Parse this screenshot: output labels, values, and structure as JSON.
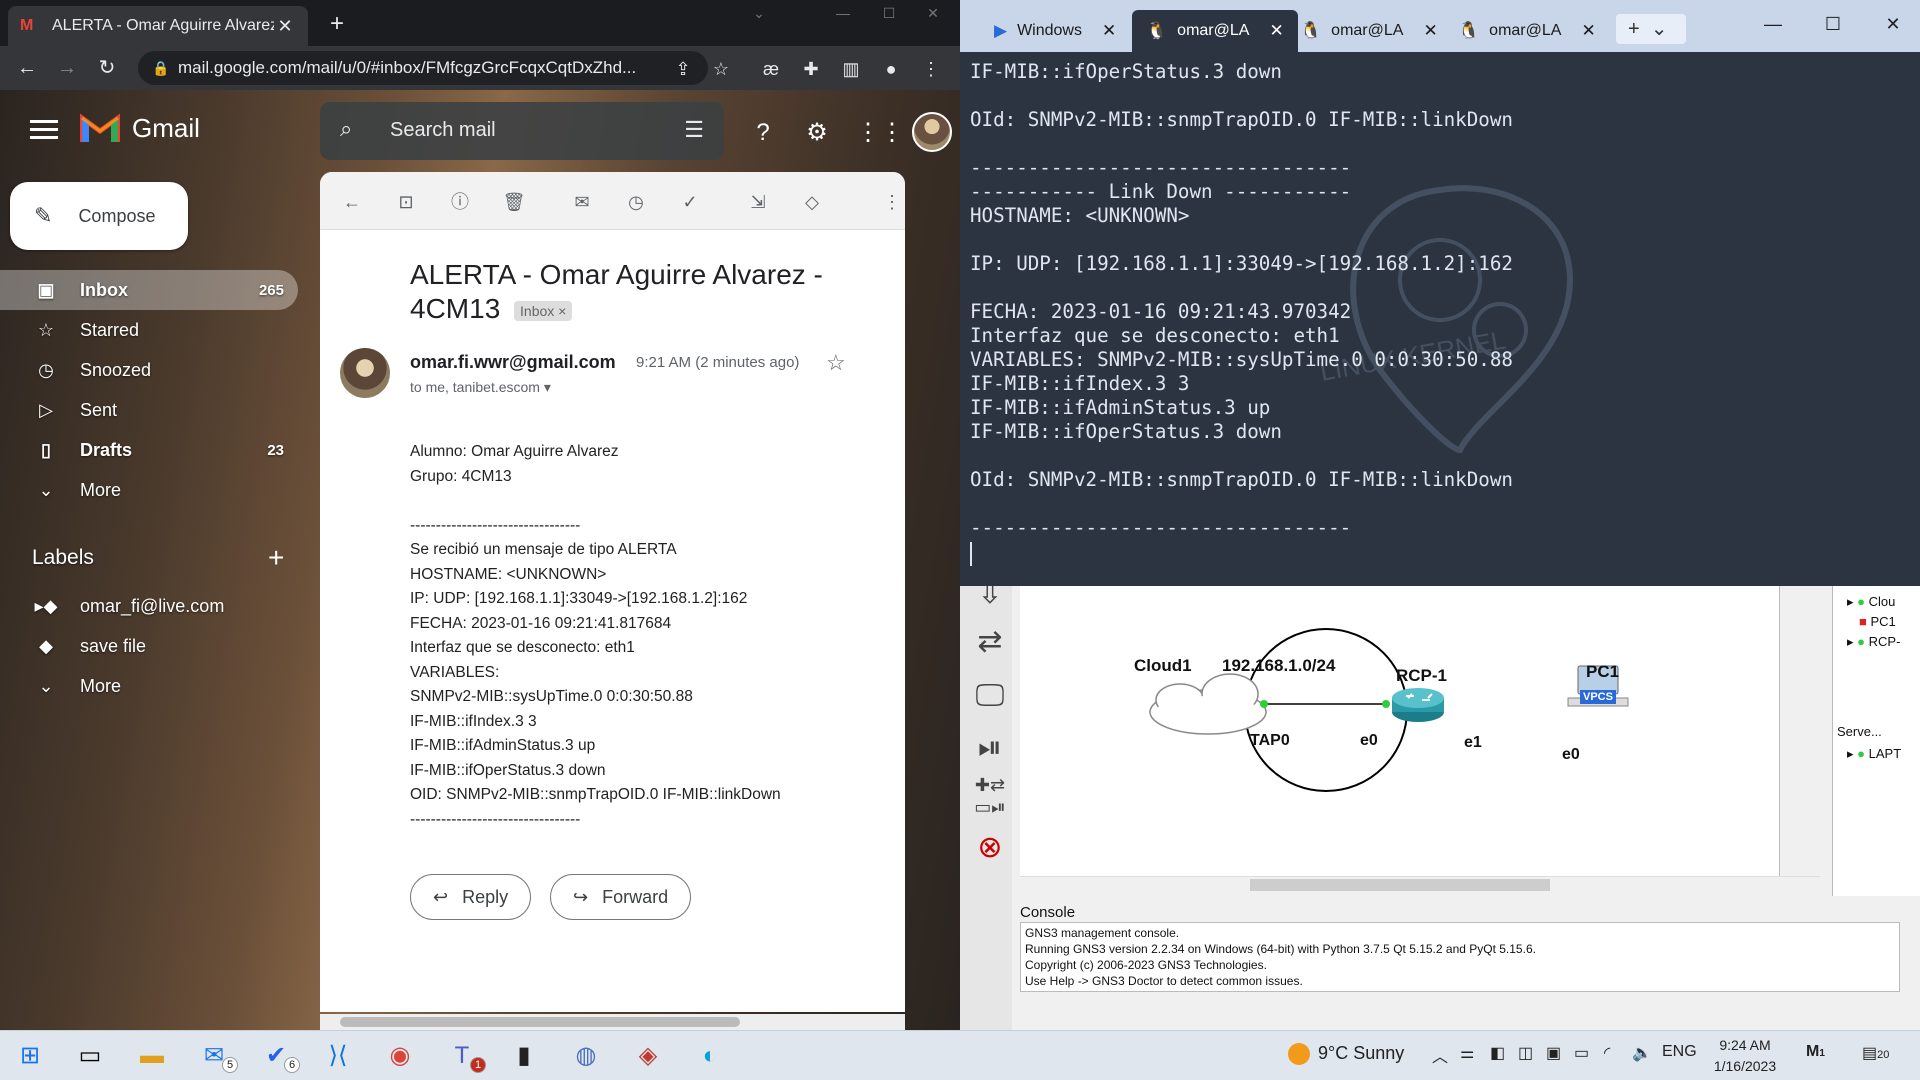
{
  "browser": {
    "tab_title": "ALERTA - Omar Aguirre Alvarez -",
    "url": "mail.google.com/mail/u/0/#inbox/FMfcgzGrcFcqxCqtDxZhd..."
  },
  "gmail": {
    "brand": "Gmail",
    "search_placeholder": "Search mail",
    "compose_label": "Compose",
    "nav": [
      {
        "label": "Inbox",
        "count": "265",
        "icon": "inbox-icon"
      },
      {
        "label": "Starred",
        "count": "",
        "icon": "star-icon"
      },
      {
        "label": "Snoozed",
        "count": "",
        "icon": "clock-icon"
      },
      {
        "label": "Sent",
        "count": "",
        "icon": "send-icon"
      },
      {
        "label": "Drafts",
        "count": "23",
        "icon": "draft-icon"
      },
      {
        "label": "More",
        "count": "",
        "icon": "chevron-down-icon"
      }
    ],
    "labels_heading": "Labels",
    "labels": [
      {
        "label": "omar_fi@live.com"
      },
      {
        "label": "save file"
      },
      {
        "label": "More"
      }
    ],
    "message": {
      "subject": "ALERTA - Omar Aguirre Alvarez - 4CM13",
      "chip": "Inbox",
      "from": "omar.fi.wwr@gmail.com",
      "time": "9:21 AM (2 minutes ago)",
      "to": "to me, tanibet.escom",
      "body": "Alumno: Omar Aguirre Alvarez\nGrupo: 4CM13\n\n---------------------------------\nSe recibió un mensaje de tipo ALERTA\nHOSTNAME: <UNKNOWN>\nIP: UDP: [192.168.1.1]:33049->[192.168.1.2]:162\nFECHA: 2023-01-16 09:21:41.817684\nInterfaz que se desconecto: eth1\nVARIABLES:\nSNMPv2-MIB::sysUpTime.0 0:0:30:50.88\nIF-MIB::ifIndex.3 3\nIF-MIB::ifAdminStatus.3 up\nIF-MIB::ifOperStatus.3 down\nOID: SNMPv2-MIB::snmpTrapOID.0 IF-MIB::linkDown\n---------------------------------",
      "reply_label": "Reply",
      "forward_label": "Forward"
    }
  },
  "terminal": {
    "tabs": [
      {
        "label": "Windows",
        "icon": "powershell-icon"
      },
      {
        "label": "omar@LA",
        "icon": "linux-icon"
      },
      {
        "label": "omar@LA",
        "icon": "linux-icon"
      },
      {
        "label": "omar@LA",
        "icon": "linux-icon"
      }
    ],
    "watermark": "LINUX KERNEL",
    "text": "IF-MIB::ifOperStatus.3 down\n\nOId: SNMPv2-MIB::snmpTrapOID.0 IF-MIB::linkDown\n\n---------------------------------\n----------- Link Down -----------\nHOSTNAME: <UNKNOWN>\n\nIP: UDP: [192.168.1.1]:33049->[192.168.1.2]:162\n\nFECHA: 2023-01-16 09:21:43.970342\nInterfaz que se desconecto: eth1\nVARIABLES: SNMPv2-MIB::sysUpTime.0 0:0:30:50.88\nIF-MIB::ifIndex.3 3\nIF-MIB::ifAdminStatus.3 up\nIF-MIB::ifOperStatus.3 down\n\nOId: SNMPv2-MIB::snmpTrapOID.0 IF-MIB::linkDown\n\n---------------------------------"
  },
  "gns3": {
    "nodes": {
      "cloud": "Cloud1",
      "network": "192.168.1.0/24",
      "router": "RCP-1",
      "pc": "PC1",
      "pc_badge": "VPCS",
      "tap": "TAP0",
      "router_e0": "e0",
      "router_e1": "e1",
      "pc_e0": "e0"
    },
    "topology_items": [
      "Clou",
      "PC1",
      "RCP-"
    ],
    "servers_label": "Serve...",
    "server_item": "LAPT",
    "console_title": "Console",
    "console_text": "GNS3 management console.\nRunning GNS3 version 2.2.34 on Windows (64-bit) with Python 3.7.5 Qt 5.15.2 and PyQt 5.15.6.\nCopyright (c) 2006-2023 GNS3 Technologies.\nUse Help -> GNS3 Doctor to detect common issues."
  },
  "taskbar": {
    "mail_badge": "5",
    "todo_badge": "6",
    "teams_badge": "1",
    "weather": "9°C  Sunny",
    "lang": "ENG",
    "time": "9:24 AM",
    "date": "1/16/2023",
    "notif": "20",
    "notif_small": "1"
  }
}
